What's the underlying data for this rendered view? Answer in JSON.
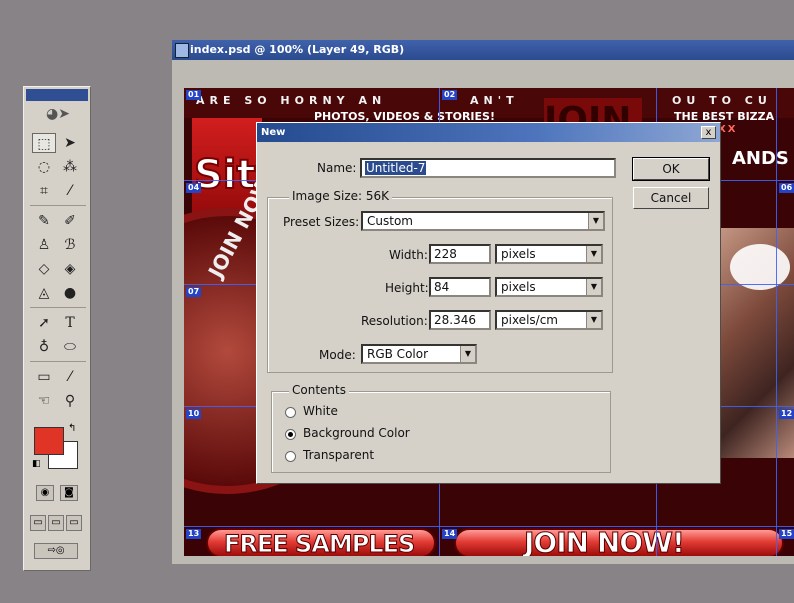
{
  "document": {
    "title": "index.psd @ 100% (Layer 49, RGB)",
    "slices": [
      "01",
      "02",
      "04",
      "06",
      "07",
      "10",
      "12",
      "13",
      "14",
      "15"
    ],
    "banner_top": "ARE SO HORNY AN",
    "banner_top2": "AN'T",
    "banner_top3": "OU TO CU",
    "tagline": "PHOTOS, VIDEOS & STORIES!",
    "best": "THE BEST BIZZA",
    "xxx": "T XXX",
    "join_big": "JOIN",
    "brands": "ANDS OF",
    "site": "Sit",
    "now_arc": "JOIN NOW",
    "free_samples": "FREE SAMPLES",
    "join_now": "JOIN NOW!"
  },
  "toolbox": {
    "tools": [
      "marquee-icon",
      "move-icon",
      "lasso-icon",
      "magic-wand-icon",
      "crop-icon",
      "slice-icon",
      "healing-icon",
      "brush-icon",
      "stamp-icon",
      "history-brush-icon",
      "eraser-icon",
      "bucket-icon",
      "blur-icon",
      "dodge-icon",
      "path-select-icon",
      "type-icon",
      "pen-icon",
      "shape-icon",
      "notes-icon",
      "eyedropper-icon",
      "hand-icon",
      "zoom-icon"
    ],
    "colors": {
      "foreground": "#e03426",
      "background": "#ffffff"
    }
  },
  "dialog": {
    "title": "New",
    "close": "x",
    "name_label": "Name:",
    "name_value": "Untitled-7",
    "image_size_label": "Image Size: 56K",
    "preset_label": "Preset Sizes:",
    "preset_value": "Custom",
    "width_label": "Width:",
    "width_value": "228",
    "width_unit": "pixels",
    "height_label": "Height:",
    "height_value": "84",
    "height_unit": "pixels",
    "resolution_label": "Resolution:",
    "resolution_value": "28.346",
    "resolution_unit": "pixels/cm",
    "mode_label": "Mode:",
    "mode_value": "RGB Color",
    "contents_label": "Contents",
    "radio_white": "White",
    "radio_background": "Background Color",
    "radio_transparent": "Transparent",
    "ok": "OK",
    "cancel": "Cancel"
  }
}
